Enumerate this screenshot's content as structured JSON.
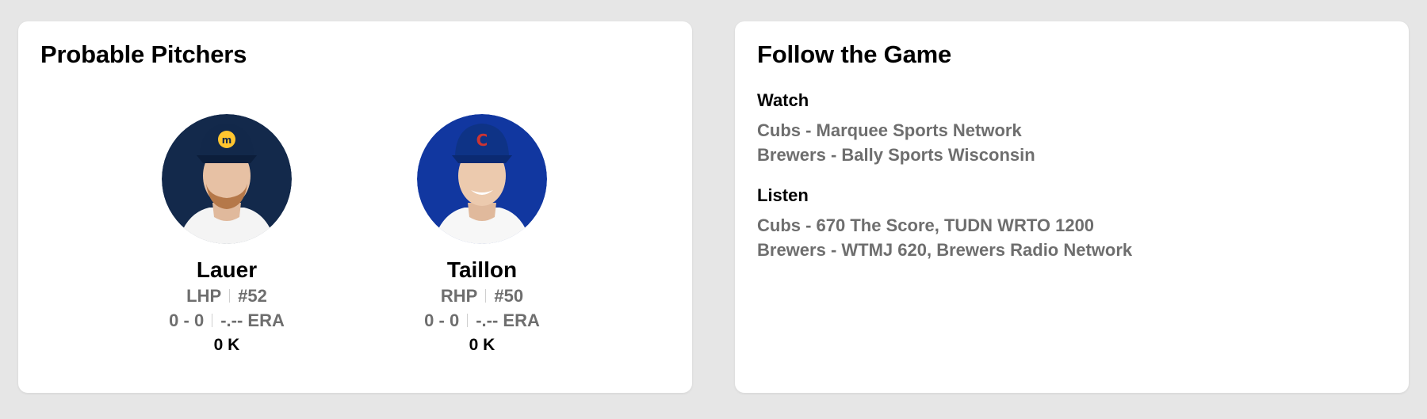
{
  "probable_pitchers": {
    "title": "Probable Pitchers",
    "pitchers": [
      {
        "name": "Lauer",
        "position": "LHP",
        "number": "#52",
        "record": "0 - 0",
        "era": "-.-- ERA",
        "strikeouts": "0 K",
        "team_color": "#13294b"
      },
      {
        "name": "Taillon",
        "position": "RHP",
        "number": "#50",
        "record": "0 - 0",
        "era": "-.-- ERA",
        "strikeouts": "0 K",
        "team_color": "#0e3386"
      }
    ]
  },
  "follow_game": {
    "title": "Follow the Game",
    "watch": {
      "label": "Watch",
      "lines": [
        "Cubs - Marquee Sports Network",
        "Brewers - Bally Sports Wisconsin"
      ]
    },
    "listen": {
      "label": "Listen",
      "lines": [
        "Cubs - 670 The Score, TUDN WRTO 1200",
        "Brewers - WTMJ 620, Brewers Radio Network"
      ]
    }
  }
}
